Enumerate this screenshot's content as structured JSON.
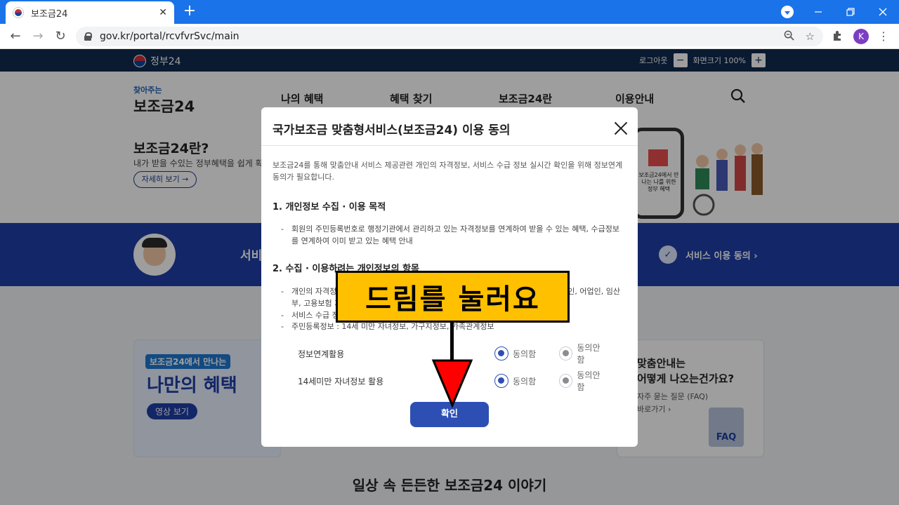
{
  "browser": {
    "tab_title": "보조금24",
    "tab_close": "✕",
    "new_tab": "+",
    "url": "gov.kr/portal/rcvfvrSvc/main",
    "profile_initial": "K"
  },
  "site": {
    "gov_logo": "정부24",
    "logout": "로그아웃",
    "zoom_minus": "−",
    "zoom_label": "화면크기 100%",
    "zoom_plus": "+",
    "brand_small": "찾아주는",
    "brand_big": "보조금24",
    "nav": [
      "나의 혜택",
      "혜택 찾기",
      "보조금24란",
      "이용안내"
    ],
    "intro_heading": "보조금24란?",
    "intro_sub": "내가 받을 수있는 정부혜택을 쉽게 확",
    "intro_more": "자세히 보기 →",
    "phone_text": "보조금24에서 만나는 나를 위한 정부 혜택",
    "band_left": "서비",
    "band_right": "서비스 이용 동의  ›",
    "card1_top": "보조금24에서 만나는",
    "card1_big": "나만의 혜택",
    "card1_btn": "영상 보기",
    "card3_t1": "맞춤안내는\n어떻게 나오는건가요?",
    "card3_t2": "자주 묻는 질문 (FAQ)\n바로가기 ›",
    "card3_faq": "FAQ",
    "bottom_title": "일상 속 든든한 보조금24 이야기"
  },
  "modal": {
    "title": "국가보조금 맞춤형서비스(보조금24) 이용 동의",
    "intro": "보조금24를 통해 맞춤안내 서비스 제공관련 개인의 자격정보, 서비스 수급 정보 실시간 확인을 위해 정보연계 동의가 필요합니다.",
    "section1_title": "1. 개인정보 수집 · 이용 목적",
    "section1_items": [
      "회원의 주민등록번호로 행정기관에서 관리하고 있는 자격정보를 연계하여 받을 수 있는 혜택, 수급정보를 연계하여 이미 받고 있는 혜택 안내"
    ],
    "section2_title": "2. 수집 · 이용하려는 개인정보의 항목",
    "section2_items": [
      "개인의 자격정보 : 장애인, 국가유공자, 기초생활수급자, 차상위계층, 한부모가족, 농업인, 어업인, 임산부, 고용보험 가입자 등",
      "서비스 수급 정보",
      "주민등록정보 : 14세 미만 자녀정보, 가구지정보, 가족관계정보"
    ],
    "rows": [
      {
        "label": "정보연계활용",
        "agree": "동의함",
        "disagree": "동의안함"
      },
      {
        "label": "14세미만 자녀정보 활용",
        "agree": "동의함",
        "disagree": "동의안함"
      }
    ],
    "confirm": "확인"
  },
  "annotation": {
    "callout_text": "드림를 눌러요"
  },
  "colors": {
    "chrome_blue": "#1a73e8",
    "modal_primary": "#2d4fb4",
    "callout_yellow": "#ffc000",
    "arrow_red": "#ff0000"
  }
}
